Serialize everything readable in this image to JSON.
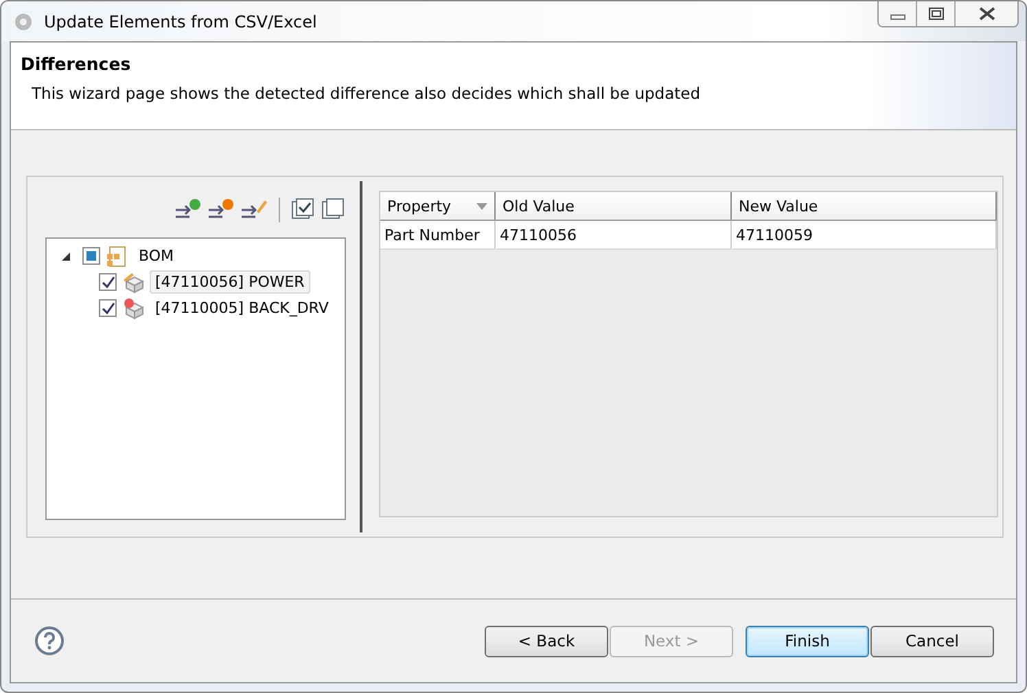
{
  "window": {
    "title": "Update Elements from CSV/Excel"
  },
  "header": {
    "title": "Differences",
    "description": "This wizard page shows the detected difference also decides which shall be updated"
  },
  "tree": {
    "items": [
      {
        "label": "BOM",
        "expanded": true,
        "checked": false,
        "partial": true,
        "selected": false,
        "children": [
          {
            "label": "[47110056] POWER",
            "checked": true,
            "selected": true,
            "kind": "changed"
          },
          {
            "label": "[47110005] BACK_DRV",
            "checked": true,
            "selected": false,
            "kind": "removed"
          }
        ]
      }
    ]
  },
  "table": {
    "columns": [
      {
        "label": "Property",
        "sorted": true
      },
      {
        "label": "Old Value",
        "sorted": false
      },
      {
        "label": "New Value",
        "sorted": false
      }
    ],
    "rows": [
      [
        "Part Number",
        "47110056",
        "47110059"
      ]
    ]
  },
  "buttons": [
    {
      "label": "< Back",
      "disabled": false,
      "default": false
    },
    {
      "label": "Next >",
      "disabled": true,
      "default": false
    },
    {
      "label": "Finish",
      "disabled": false,
      "default": true
    },
    {
      "label": "Cancel",
      "disabled": false,
      "default": false
    }
  ]
}
